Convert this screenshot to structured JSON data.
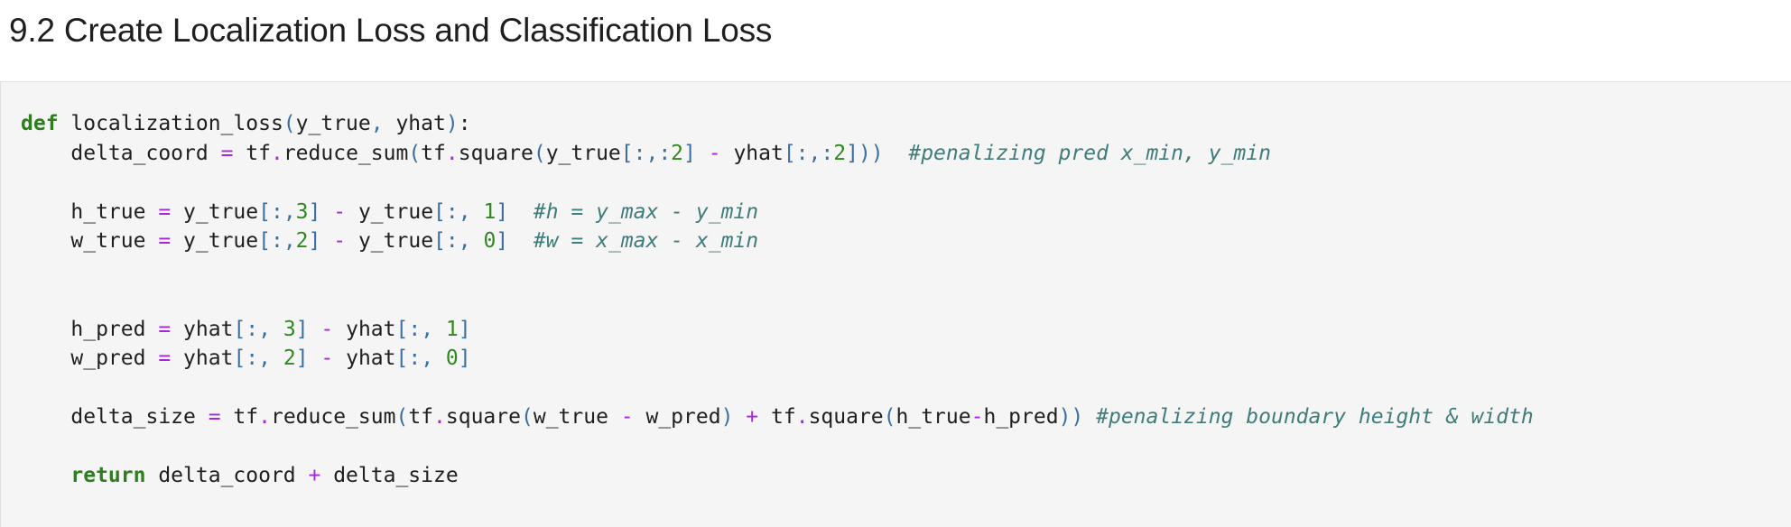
{
  "heading": "9.2 Create Localization Loss and Classification Loss",
  "code_lines": [
    [
      [
        "kw",
        "def"
      ],
      [
        "tx",
        " localization_loss"
      ],
      [
        "br",
        "("
      ],
      [
        "tx",
        "y_true"
      ],
      [
        "br",
        ","
      ],
      [
        "tx",
        " yhat"
      ],
      [
        "br",
        ")"
      ],
      [
        "tx",
        ":"
      ]
    ],
    [
      [
        "tx",
        "    delta_coord "
      ],
      [
        "op",
        "="
      ],
      [
        "tx",
        " tf"
      ],
      [
        "op",
        "."
      ],
      [
        "tx",
        "reduce_sum"
      ],
      [
        "br",
        "("
      ],
      [
        "tx",
        "tf"
      ],
      [
        "op",
        "."
      ],
      [
        "tx",
        "square"
      ],
      [
        "br",
        "("
      ],
      [
        "tx",
        "y_true"
      ],
      [
        "br",
        "[:,:"
      ],
      [
        "num",
        "2"
      ],
      [
        "br",
        "]"
      ],
      [
        "tx",
        " "
      ],
      [
        "op",
        "-"
      ],
      [
        "tx",
        " yhat"
      ],
      [
        "br",
        "[:,:"
      ],
      [
        "num",
        "2"
      ],
      [
        "br",
        "]))"
      ],
      [
        "tx",
        "  "
      ],
      [
        "cm",
        "#penalizing pred x_min, y_min"
      ]
    ],
    [],
    [
      [
        "tx",
        "    h_true "
      ],
      [
        "op",
        "="
      ],
      [
        "tx",
        " y_true"
      ],
      [
        "br",
        "[:,"
      ],
      [
        "num",
        "3"
      ],
      [
        "br",
        "]"
      ],
      [
        "tx",
        " "
      ],
      [
        "op",
        "-"
      ],
      [
        "tx",
        " y_true"
      ],
      [
        "br",
        "[:, "
      ],
      [
        "num",
        "1"
      ],
      [
        "br",
        "]"
      ],
      [
        "tx",
        "  "
      ],
      [
        "cm",
        "#h = y_max - y_min"
      ]
    ],
    [
      [
        "tx",
        "    w_true "
      ],
      [
        "op",
        "="
      ],
      [
        "tx",
        " y_true"
      ],
      [
        "br",
        "[:,"
      ],
      [
        "num",
        "2"
      ],
      [
        "br",
        "]"
      ],
      [
        "tx",
        " "
      ],
      [
        "op",
        "-"
      ],
      [
        "tx",
        " y_true"
      ],
      [
        "br",
        "[:, "
      ],
      [
        "num",
        "0"
      ],
      [
        "br",
        "]"
      ],
      [
        "tx",
        "  "
      ],
      [
        "cm",
        "#w = x_max - x_min"
      ]
    ],
    [],
    [],
    [
      [
        "tx",
        "    h_pred "
      ],
      [
        "op",
        "="
      ],
      [
        "tx",
        " yhat"
      ],
      [
        "br",
        "[:, "
      ],
      [
        "num",
        "3"
      ],
      [
        "br",
        "]"
      ],
      [
        "tx",
        " "
      ],
      [
        "op",
        "-"
      ],
      [
        "tx",
        " yhat"
      ],
      [
        "br",
        "[:, "
      ],
      [
        "num",
        "1"
      ],
      [
        "br",
        "]"
      ]
    ],
    [
      [
        "tx",
        "    w_pred "
      ],
      [
        "op",
        "="
      ],
      [
        "tx",
        " yhat"
      ],
      [
        "br",
        "[:, "
      ],
      [
        "num",
        "2"
      ],
      [
        "br",
        "]"
      ],
      [
        "tx",
        " "
      ],
      [
        "op",
        "-"
      ],
      [
        "tx",
        " yhat"
      ],
      [
        "br",
        "[:, "
      ],
      [
        "num",
        "0"
      ],
      [
        "br",
        "]"
      ]
    ],
    [],
    [
      [
        "tx",
        "    delta_size "
      ],
      [
        "op",
        "="
      ],
      [
        "tx",
        " tf"
      ],
      [
        "op",
        "."
      ],
      [
        "tx",
        "reduce_sum"
      ],
      [
        "br",
        "("
      ],
      [
        "tx",
        "tf"
      ],
      [
        "op",
        "."
      ],
      [
        "tx",
        "square"
      ],
      [
        "br",
        "("
      ],
      [
        "tx",
        "w_true "
      ],
      [
        "op",
        "-"
      ],
      [
        "tx",
        " w_pred"
      ],
      [
        "br",
        ")"
      ],
      [
        "tx",
        " "
      ],
      [
        "op",
        "+"
      ],
      [
        "tx",
        " tf"
      ],
      [
        "op",
        "."
      ],
      [
        "tx",
        "square"
      ],
      [
        "br",
        "("
      ],
      [
        "tx",
        "h_true"
      ],
      [
        "op",
        "-"
      ],
      [
        "tx",
        "h_pred"
      ],
      [
        "br",
        "))"
      ],
      [
        "tx",
        " "
      ],
      [
        "cm",
        "#penalizing boundary height & width"
      ]
    ],
    [],
    [
      [
        "tx",
        "    "
      ],
      [
        "kw",
        "return"
      ],
      [
        "tx",
        " delta_coord "
      ],
      [
        "op",
        "+"
      ],
      [
        "tx",
        " delta_size"
      ]
    ]
  ],
  "colors": {
    "keyword": "#2e7d1f",
    "operator": "#a626d9",
    "bracket": "#3b6fa3",
    "number": "#2f8a1e",
    "comment": "#3f7c7a",
    "cell_background": "#f5f5f5"
  }
}
